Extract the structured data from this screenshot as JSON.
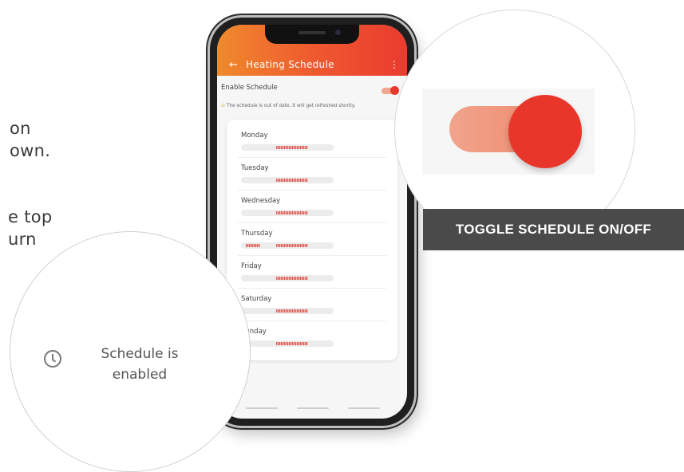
{
  "background_text": {
    "line1": "on",
    "line2": "own.",
    "line3": "e top",
    "line4": "urn"
  },
  "app": {
    "back_icon": "arrow-left-icon",
    "title": "Heating Schedule",
    "more_icon": "more-vertical-icon",
    "enable_label": "Enable Schedule",
    "enable_on": true,
    "notice": "The schedule is out of date, it will get refreshed shortly.",
    "accent": "#e8372c",
    "appbar_gradient": [
      "#ef8a2c",
      "#ea3b2f"
    ]
  },
  "days": [
    {
      "name": "Monday"
    },
    {
      "name": "Tuesday"
    },
    {
      "name": "Wednesday"
    },
    {
      "name": "Thursday"
    },
    {
      "name": "Friday"
    },
    {
      "name": "Saturday"
    },
    {
      "name": "Sunday"
    }
  ],
  "callouts": {
    "toggle_caption": "TOGGLE SCHEDULE ON/OFF",
    "status_line1": "Schedule is",
    "status_line2": "enabled",
    "status_icon": "clock-icon"
  }
}
